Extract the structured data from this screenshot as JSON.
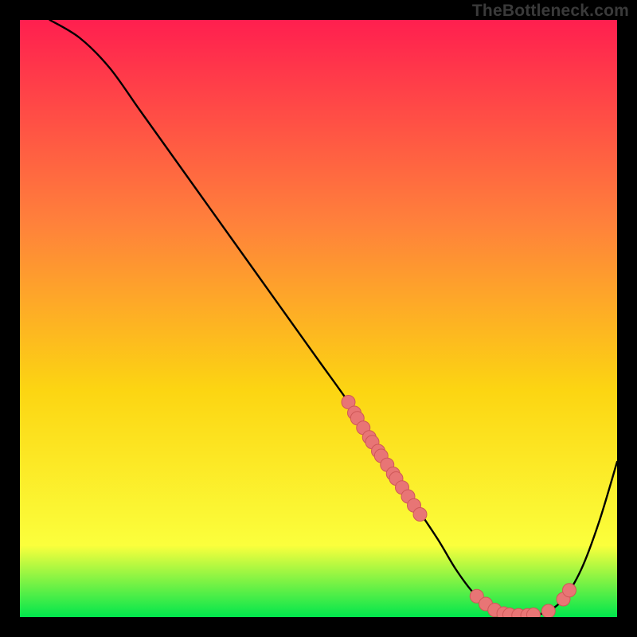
{
  "watermark": "TheBottleneck.com",
  "colors": {
    "gradient_top": "#ff1f4f",
    "gradient_upper_mid": "#ff813b",
    "gradient_mid": "#fcd512",
    "gradient_lower_mid": "#fbff3c",
    "gradient_bottom": "#00e64d",
    "line": "#000000",
    "marker_fill": "#e87575",
    "marker_stroke": "#cf5858",
    "background": "#000000"
  },
  "chart_data": {
    "type": "line",
    "title": "",
    "xlabel": "",
    "ylabel": "",
    "xlim": [
      0,
      100
    ],
    "ylim": [
      0,
      100
    ],
    "axes_visible": false,
    "series": [
      {
        "name": "bottleneck-curve",
        "x": [
          5,
          10,
          15,
          20,
          25,
          30,
          35,
          40,
          45,
          50,
          55,
          58,
          62,
          66,
          70,
          73,
          76,
          79,
          82,
          85,
          88,
          91,
          94,
          97,
          100
        ],
        "y": [
          100,
          97,
          92,
          85,
          78,
          71,
          64,
          57,
          50,
          43,
          36,
          31,
          25,
          19,
          13,
          8,
          4,
          1.5,
          0.5,
          0.3,
          0.8,
          3,
          8,
          16,
          26
        ]
      }
    ],
    "markers": [
      {
        "x": 55.0,
        "y": 36.0
      },
      {
        "x": 56.0,
        "y": 34.2
      },
      {
        "x": 56.5,
        "y": 33.3
      },
      {
        "x": 57.5,
        "y": 31.7
      },
      {
        "x": 58.5,
        "y": 30.1
      },
      {
        "x": 59.0,
        "y": 29.3
      },
      {
        "x": 60.0,
        "y": 27.8
      },
      {
        "x": 60.5,
        "y": 27.0
      },
      {
        "x": 61.5,
        "y": 25.5
      },
      {
        "x": 62.5,
        "y": 24.0
      },
      {
        "x": 63.0,
        "y": 23.2
      },
      {
        "x": 64.0,
        "y": 21.7
      },
      {
        "x": 65.0,
        "y": 20.2
      },
      {
        "x": 66.0,
        "y": 18.7
      },
      {
        "x": 67.0,
        "y": 17.2
      },
      {
        "x": 76.5,
        "y": 3.5
      },
      {
        "x": 78.0,
        "y": 2.2
      },
      {
        "x": 79.5,
        "y": 1.2
      },
      {
        "x": 81.0,
        "y": 0.6
      },
      {
        "x": 82.0,
        "y": 0.4
      },
      {
        "x": 83.5,
        "y": 0.3
      },
      {
        "x": 85.0,
        "y": 0.3
      },
      {
        "x": 86.0,
        "y": 0.4
      },
      {
        "x": 88.5,
        "y": 1.0
      },
      {
        "x": 91.0,
        "y": 3.0
      },
      {
        "x": 92.0,
        "y": 4.5
      }
    ]
  }
}
